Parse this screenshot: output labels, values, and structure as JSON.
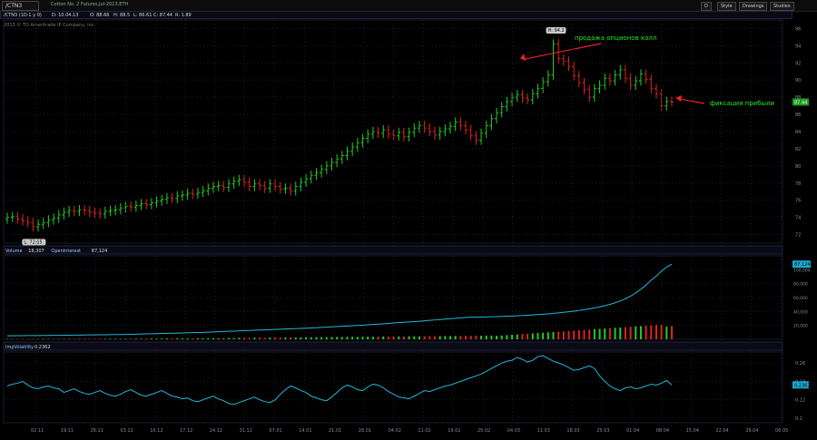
{
  "toolbar": {
    "symbol": "/CTN3",
    "description": "Cotton No. 2 Futures,Jul-2013,ETH",
    "buttons": [
      "D",
      "Style",
      "Drawings",
      "Studies"
    ]
  },
  "quote": {
    "symbol": "/CTN3 (1D:1 y 0)",
    "date": "D: 10.04.13",
    "open": "O: 88.66",
    "high": "H: 88.5",
    "low": "L: 86.61",
    "close": "C: 87.44",
    "range": "R: 1.89"
  },
  "copyright": "2013 © TD Ameritrade IP Company, Inc.",
  "colors": {
    "up": "#22cc22",
    "down": "#dd2222",
    "line": "#22b8d8",
    "grid": "#1e2030",
    "axis": "#8a8a9a"
  },
  "chart_data": [
    {
      "type": "candlestick",
      "panel": "price",
      "y_ticks": [
        72,
        74,
        76,
        78,
        80,
        82,
        84,
        86,
        88,
        90,
        92,
        94,
        96
      ],
      "ylim": [
        71,
        97
      ],
      "current_price_label": "87.44",
      "high_label": "H: 94.2",
      "low_label": "L: 72.15",
      "annotations": [
        {
          "text": "продажа опционов колл",
          "target_index": 101
        },
        {
          "text": "фиксация прибыли",
          "target_index": 122
        }
      ],
      "close_values": [
        74.0,
        74.1,
        73.8,
        73.6,
        73.4,
        72.9,
        73.2,
        73.4,
        73.7,
        73.9,
        74.3,
        74.6,
        74.8,
        74.7,
        74.9,
        74.8,
        74.6,
        74.5,
        74.4,
        74.7,
        74.8,
        74.9,
        75.1,
        75.3,
        75.2,
        75.4,
        75.6,
        75.5,
        75.7,
        75.9,
        76.1,
        76.3,
        76.2,
        76.5,
        76.6,
        76.8,
        76.7,
        76.9,
        77.1,
        77.4,
        77.6,
        77.7,
        77.5,
        77.9,
        78.2,
        78.4,
        78.1,
        77.6,
        77.9,
        77.7,
        77.4,
        77.9,
        77.6,
        77.3,
        77.4,
        77.1,
        77.6,
        78.1,
        78.5,
        78.9,
        79.2,
        79.6,
        80.0,
        80.4,
        80.8,
        81.2,
        81.7,
        82.2,
        82.7,
        83.2,
        83.7,
        84.0,
        83.8,
        84.2,
        83.7,
        83.5,
        83.9,
        83.4,
        83.9,
        84.4,
        84.7,
        84.4,
        84.0,
        83.6,
        84.0,
        84.3,
        84.6,
        85.1,
        84.7,
        84.2,
        83.5,
        83.0,
        83.8,
        84.7,
        85.5,
        86.2,
        86.9,
        87.5,
        88.0,
        88.3,
        87.9,
        87.7,
        88.4,
        89.0,
        89.8,
        90.6,
        94.2,
        92.5,
        92.2,
        91.6,
        90.5,
        89.7,
        88.9,
        88.0,
        89.0,
        89.4,
        90.2,
        89.9,
        90.6,
        91.2,
        90.2,
        89.4,
        89.9,
        90.7,
        90.1,
        89.0,
        88.4,
        87.0,
        87.5,
        87.44
      ],
      "x_tick_labels": [
        "02.11",
        "19.11",
        "26.11",
        "03.12",
        "10.12",
        "17.12",
        "24.12",
        "31.12",
        "07.01",
        "14.01",
        "21.01",
        "28.01",
        "04.02",
        "11.02",
        "19.02",
        "25.02",
        "04.03",
        "11.03",
        "18.03",
        "25.03",
        "01.04",
        "08.04",
        "15.04",
        "22.04",
        "29.04",
        "06.05"
      ]
    },
    {
      "type": "bar+line",
      "panel": "volume",
      "labels": [
        "Volume",
        "18,307",
        "OpenInterest",
        "87,124"
      ],
      "y_ticks": [
        "20,000",
        "40,000",
        "60,000",
        "80,000",
        "100,000"
      ],
      "ylim": [
        0,
        120000
      ],
      "current_label": "87,124",
      "open_interest": [
        5000,
        5100,
        5150,
        5200,
        5300,
        5350,
        5400,
        5500,
        5600,
        5650,
        5700,
        5800,
        5900,
        6000,
        6100,
        6200,
        6300,
        6400,
        6500,
        6600,
        6700,
        6800,
        6900,
        7000,
        7200,
        7400,
        7600,
        7800,
        8000,
        8200,
        8400,
        8600,
        8800,
        9000,
        9200,
        9400,
        9600,
        9800,
        10000,
        10300,
        10600,
        10900,
        11200,
        11500,
        11800,
        12100,
        12400,
        12700,
        13000,
        13300,
        13600,
        13900,
        14200,
        14500,
        14800,
        15100,
        15400,
        15700,
        16000,
        16300,
        16700,
        17100,
        17500,
        17900,
        18300,
        18700,
        19100,
        19500,
        19900,
        20400,
        20900,
        21400,
        21900,
        22400,
        22900,
        23400,
        23900,
        24400,
        24900,
        25400,
        26000,
        26600,
        27200,
        27800,
        28400,
        29000,
        29600,
        30200,
        30800,
        31400,
        31800,
        31900,
        32000,
        32200,
        32400,
        32600,
        32900,
        33200,
        33500,
        33800,
        34200,
        34600,
        35000,
        35500,
        36000,
        36600,
        37300,
        38000,
        38800,
        39600,
        40500,
        41500,
        42600,
        43800,
        45100,
        46600,
        48300,
        50200,
        52500,
        55200,
        58300,
        62000,
        66500,
        72000,
        78000,
        85000,
        91000,
        98000,
        104000,
        108000
      ],
      "volume": [
        600,
        400,
        500,
        450,
        550,
        600,
        500,
        700,
        650,
        400,
        500,
        600,
        550,
        700,
        650,
        800,
        600,
        700,
        750,
        800,
        900,
        850,
        700,
        800,
        900,
        1000,
        950,
        1100,
        1200,
        1000,
        1100,
        1300,
        1200,
        1400,
        1300,
        1500,
        1400,
        1600,
        1500,
        1700,
        1800,
        1600,
        1900,
        2000,
        1800,
        2100,
        2200,
        2000,
        2300,
        2400,
        2200,
        2500,
        2600,
        2400,
        2700,
        2800,
        2600,
        2900,
        3000,
        2800,
        3100,
        3200,
        3000,
        3300,
        3400,
        3200,
        3500,
        3600,
        3400,
        3700,
        3800,
        3600,
        3900,
        4000,
        3800,
        4100,
        4200,
        4000,
        4300,
        4400,
        4200,
        4500,
        4600,
        4400,
        4700,
        4800,
        4600,
        4900,
        5000,
        4800,
        5100,
        5200,
        5000,
        5300,
        5400,
        5200,
        5500,
        6000,
        6500,
        7000,
        7500,
        8000,
        8500,
        9000,
        9500,
        10000,
        10500,
        11000,
        11500,
        12000,
        12500,
        13000,
        13500,
        14000,
        14500,
        15000,
        15500,
        16000,
        16500,
        17000,
        17500,
        18000,
        18500,
        19000,
        19500,
        20000,
        20500,
        21000,
        18307,
        19000
      ]
    },
    {
      "type": "line",
      "panel": "implied-volatility",
      "labels": [
        "ImpVolatility",
        "0.2362"
      ],
      "y_ticks": [
        "0.2",
        "0.22",
        "0.24",
        "0.26"
      ],
      "ylim": [
        0.195,
        0.272
      ],
      "current_label": "0.2362",
      "values": [
        0.235,
        0.237,
        0.238,
        0.24,
        0.236,
        0.233,
        0.232,
        0.234,
        0.235,
        0.233,
        0.232,
        0.228,
        0.23,
        0.232,
        0.229,
        0.227,
        0.226,
        0.228,
        0.23,
        0.227,
        0.225,
        0.224,
        0.226,
        0.229,
        0.231,
        0.228,
        0.225,
        0.224,
        0.226,
        0.228,
        0.23,
        0.227,
        0.224,
        0.223,
        0.221,
        0.222,
        0.219,
        0.218,
        0.22,
        0.222,
        0.224,
        0.221,
        0.219,
        0.216,
        0.215,
        0.217,
        0.219,
        0.221,
        0.223,
        0.22,
        0.218,
        0.217,
        0.22,
        0.226,
        0.231,
        0.235,
        0.233,
        0.23,
        0.228,
        0.224,
        0.222,
        0.22,
        0.219,
        0.223,
        0.228,
        0.233,
        0.236,
        0.234,
        0.231,
        0.23,
        0.234,
        0.237,
        0.236,
        0.233,
        0.229,
        0.226,
        0.223,
        0.222,
        0.221,
        0.224,
        0.227,
        0.23,
        0.229,
        0.231,
        0.233,
        0.235,
        0.236,
        0.238,
        0.24,
        0.242,
        0.244,
        0.246,
        0.248,
        0.251,
        0.254,
        0.257,
        0.26,
        0.262,
        0.263,
        0.266,
        0.264,
        0.261,
        0.263,
        0.267,
        0.268,
        0.265,
        0.262,
        0.26,
        0.258,
        0.255,
        0.252,
        0.253,
        0.255,
        0.257,
        0.254,
        0.246,
        0.24,
        0.235,
        0.232,
        0.23,
        0.233,
        0.234,
        0.232,
        0.233,
        0.235,
        0.237,
        0.236,
        0.238,
        0.241,
        0.2362
      ]
    }
  ]
}
